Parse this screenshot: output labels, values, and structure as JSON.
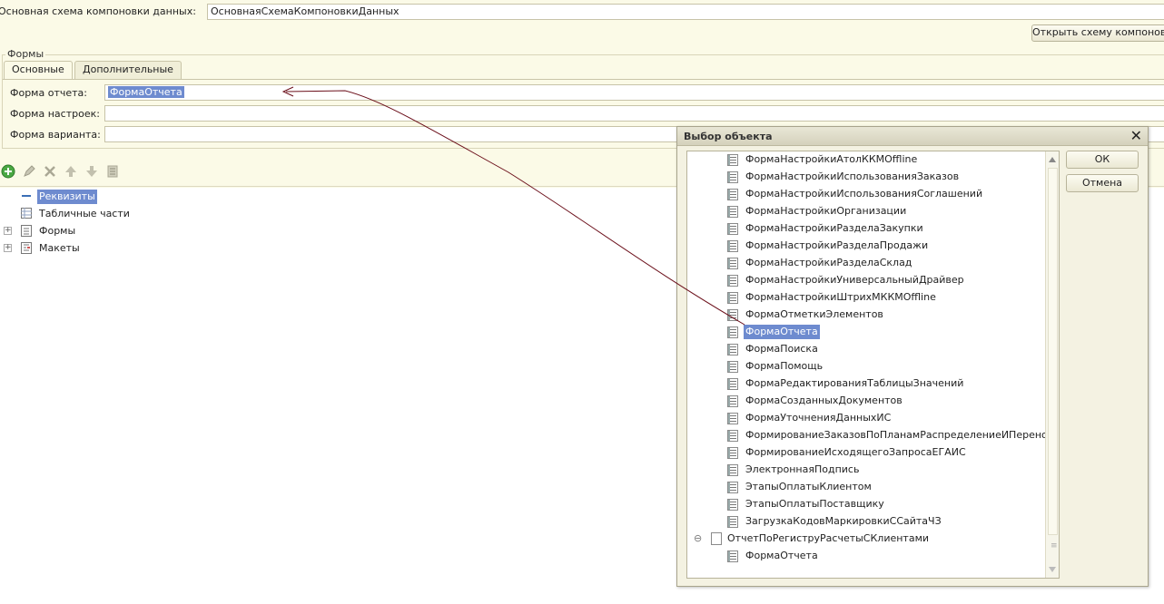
{
  "main_schema": {
    "label": "Основная схема компоновки данных:",
    "value": "ОсновнаяСхемаКомпоновкиДанных",
    "open_button": "Открыть схему компоновки"
  },
  "forms_group": {
    "title": "Формы",
    "tabs": [
      {
        "label": "Основные",
        "active": true
      },
      {
        "label": "Дополнительные",
        "active": false
      }
    ],
    "fields": [
      {
        "label": "Форма отчета:",
        "value": "ФормаОтчета"
      },
      {
        "label": "Форма настроек:",
        "value": ""
      },
      {
        "label": "Форма варианта:",
        "value": ""
      }
    ]
  },
  "toolbar": {
    "icons": [
      "add-icon",
      "edit-icon",
      "delete-icon",
      "move-up-icon",
      "move-down-icon",
      "sort-icon"
    ]
  },
  "tree": {
    "items": [
      {
        "label": "Реквизиты",
        "selected": true,
        "expandable": false,
        "icon": "attributes-icon"
      },
      {
        "label": "Табличные части",
        "selected": false,
        "expandable": false,
        "icon": "table-icon"
      },
      {
        "label": "Формы",
        "selected": false,
        "expandable": true,
        "icon": "forms-icon"
      },
      {
        "label": "Макеты",
        "selected": false,
        "expandable": true,
        "icon": "layouts-icon"
      }
    ]
  },
  "dialog": {
    "title": "Выбор объекта",
    "ok_label": "ОК",
    "cancel_label": "Отмена",
    "items": [
      "ФормаНастройкиАтолККМOffline",
      "ФормаНастройкиИспользованияЗаказов",
      "ФормаНастройкиИспользованияСоглашений",
      "ФормаНастройкиОрганизации",
      "ФормаНастройкиРазделаЗакупки",
      "ФормаНастройкиРазделаПродажи",
      "ФормаНастройкиРазделаСклад",
      "ФормаНастройкиУниверсальныйДрайвер",
      "ФормаНастройкиШтрихМККМOffline",
      "ФормаОтметкиЭлементов",
      "ФормаОтчета",
      "ФормаПоиска",
      "ФормаПомощь",
      "ФормаРедактированияТаблицыЗначений",
      "ФормаСозданныхДокументов",
      "ФормаУточненияДанныхИС",
      "ФормированиеЗаказовПоПланамРаспределениеИПеренос",
      "ФормированиеИсходящегоЗапросаЕГАИС",
      "ЭлектроннаяПодпись",
      "ЭтапыОплатыКлиентом",
      "ЭтапыОплатыПоставщику",
      "ЗагрузкаКодовМаркировкиССайтаЧЗ"
    ],
    "selected_item": "ФормаОтчета",
    "group": {
      "label": "ОтчетПоРегиструРасчетыСКлиентами",
      "expanded": true,
      "children": [
        "ФормаОтчета"
      ]
    }
  },
  "colors": {
    "background": "#fbfae7",
    "selection": "#6e8bcf",
    "annotation_arrow": "#6b0f1a"
  }
}
